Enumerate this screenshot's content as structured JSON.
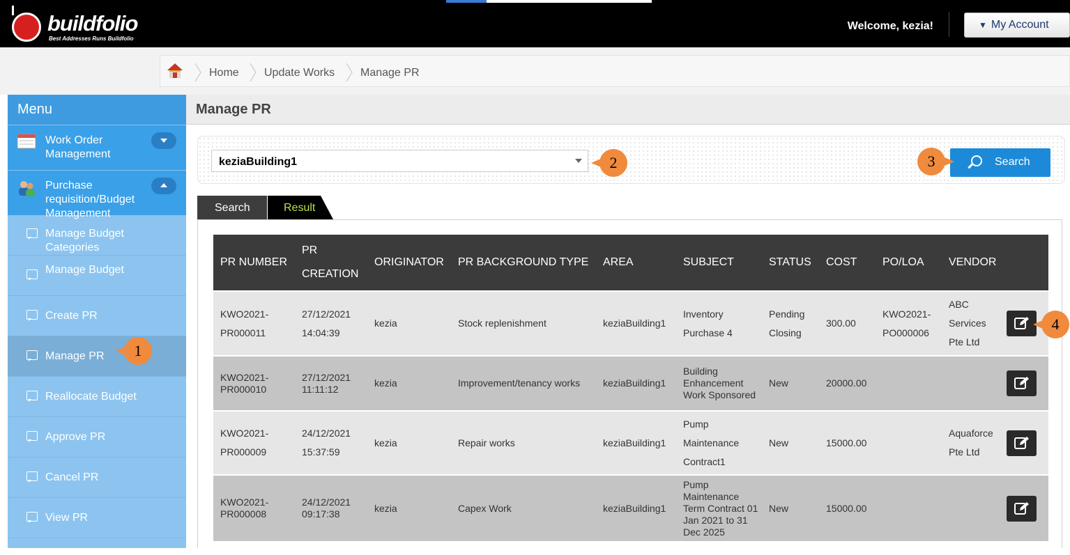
{
  "header": {
    "logo_text": "buildfolio",
    "logo_tagline": "Best Addresses Runs Buildfolio",
    "welcome": "Welcome, kezia!",
    "account_label": "My Account"
  },
  "breadcrumb": [
    "Home",
    "Update Works",
    "Manage PR"
  ],
  "sidebar": {
    "title": "Menu",
    "groups": [
      {
        "label": "Work Order Management"
      },
      {
        "label": "Purchase requisition/Budget Management"
      }
    ],
    "items": [
      {
        "label": "Manage Budget Categories"
      },
      {
        "label": "Manage Budget"
      },
      {
        "label": "Create PR"
      },
      {
        "label": "Manage PR"
      },
      {
        "label": "Reallocate Budget"
      },
      {
        "label": "Approve PR"
      },
      {
        "label": "Cancel PR"
      },
      {
        "label": "View PR"
      }
    ]
  },
  "main": {
    "title": "Manage PR",
    "building_select": "keziaBuilding1",
    "search_button": "Search",
    "tabs": [
      "Search",
      "Result"
    ],
    "active_tab": "Result",
    "table": {
      "columns": [
        "PR NUMBER",
        "PR CREATION",
        "ORIGINATOR",
        "PR BACKGROUND TYPE",
        "AREA",
        "SUBJECT",
        "STATUS",
        "COST",
        "PO/LOA",
        "VENDOR",
        ""
      ],
      "rows": [
        [
          "KWO2021-PR000011",
          "27/12/2021 14:04:39",
          "kezia",
          "Stock replenishment",
          "keziaBuilding1",
          "Inventory Purchase 4",
          "Pending Closing",
          "300.00",
          "KWO2021-PO000006",
          "ABC Services Pte Ltd"
        ],
        [
          "KWO2021-PR000010",
          "27/12/2021 11:11:12",
          "kezia",
          "Improvement/tenancy works",
          "keziaBuilding1",
          "Building Enhancement Work Sponsored",
          "New",
          "20000.00",
          "",
          ""
        ],
        [
          "KWO2021-PR000009",
          "24/12/2021 15:37:59",
          "kezia",
          "Repair works",
          "keziaBuilding1",
          "Pump Maintenance Contract1",
          "New",
          "15000.00",
          "",
          "Aquaforce Pte Ltd"
        ],
        [
          "KWO2021-PR000008",
          "24/12/2021 09:17:38",
          "kezia",
          "Capex Work",
          "keziaBuilding1",
          "Pump Maintenance Term Contract 01 Jan 2021 to 31 Dec 2025",
          "New",
          "15000.00",
          "",
          ""
        ]
      ]
    }
  },
  "callouts": [
    "1",
    "2",
    "3",
    "4"
  ],
  "colors": {
    "header_bg": "#000000",
    "sidebar_bg": "#8cc4ef",
    "sidebar_group_bg": "#3aa0e8",
    "primary_button": "#1c8ad8",
    "callout": "#f08a3c",
    "active_tab_text": "#b7e04a"
  }
}
